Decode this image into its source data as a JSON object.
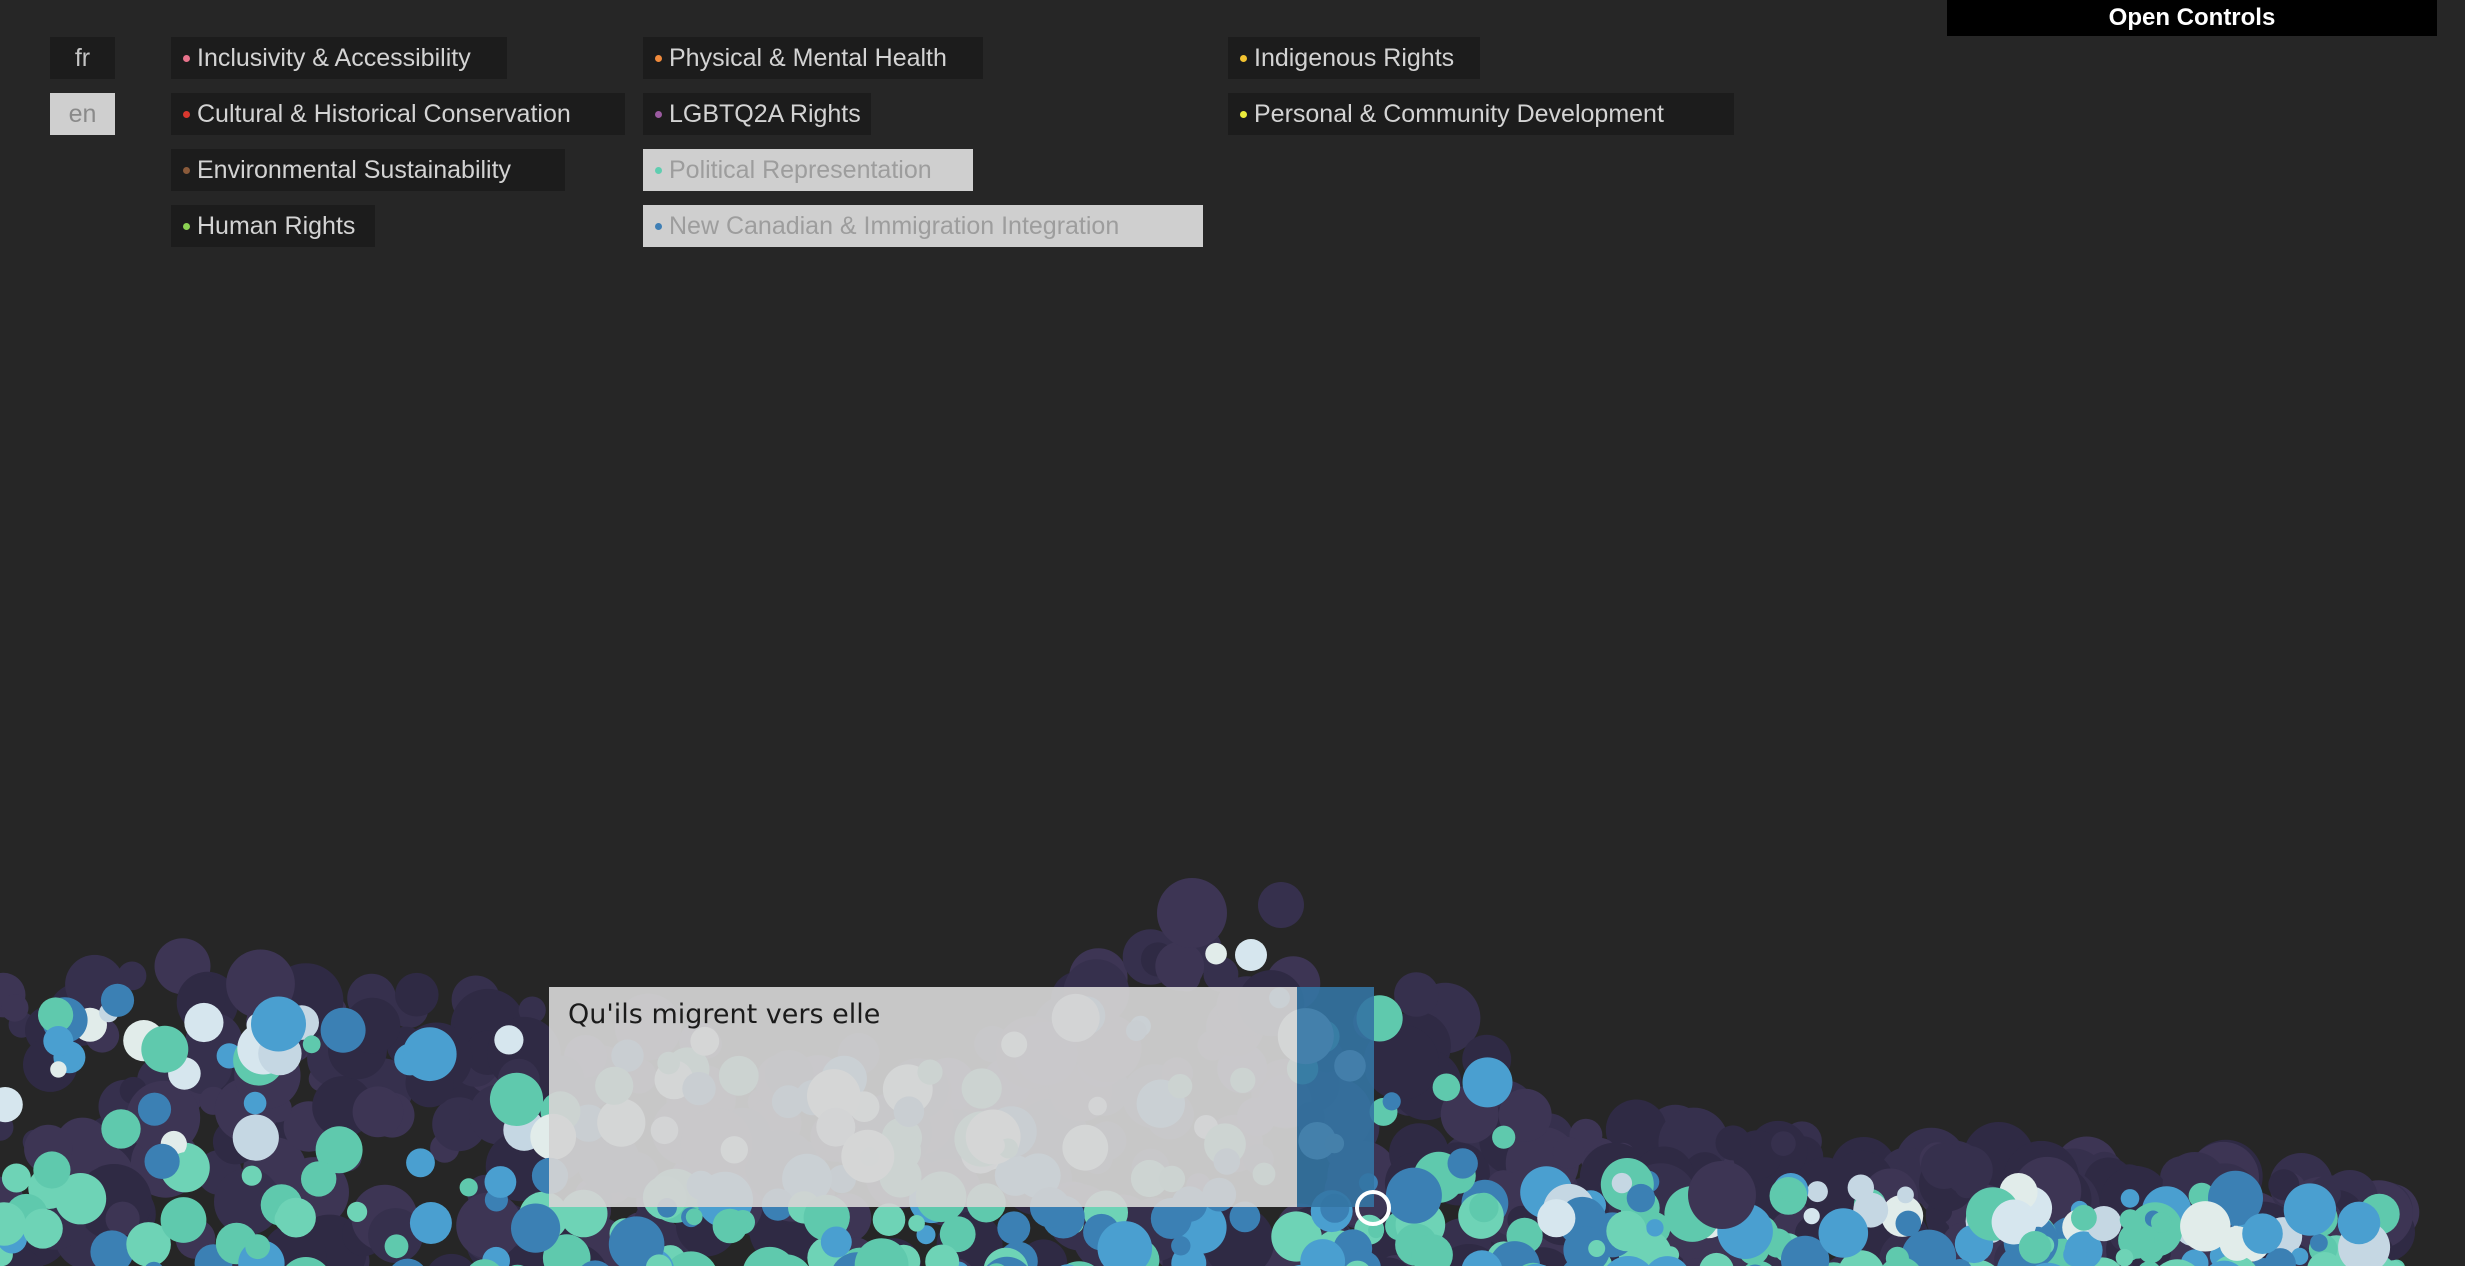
{
  "open_controls_label": "Open Controls",
  "languages": [
    {
      "label": "fr",
      "active": false
    },
    {
      "label": "en",
      "active": true
    }
  ],
  "topics": [
    {
      "label": "Inclusivity & Accessibility",
      "color": "#e8738c",
      "active": false
    },
    {
      "label": "Cultural & Historical Conservation",
      "color": "#d9372e",
      "active": false
    },
    {
      "label": "Environmental Sustainability",
      "color": "#8a5a3a",
      "active": false
    },
    {
      "label": "Human Rights",
      "color": "#8bd152",
      "active": false
    },
    {
      "label": "Physical & Mental Health",
      "color": "#f08a3c",
      "active": false
    },
    {
      "label": "LGBTQ2A Rights",
      "color": "#9b5aa0",
      "active": false
    },
    {
      "label": "Political Representation",
      "color": "#5fcdb0",
      "active": true
    },
    {
      "label": "New Canadian & Immigration Integration",
      "color": "#3f7fb5",
      "active": true
    },
    {
      "label": "Indigenous Rights",
      "color": "#f2c230",
      "active": false
    },
    {
      "label": "Personal & Community Development",
      "color": "#ecec3c",
      "active": false
    }
  ],
  "entry": {
    "text": "Qu'ils migrent vers elle"
  },
  "bubble_colors": [
    "#3d3554",
    "#36304d",
    "#2f2a44",
    "#4a9fd0",
    "#3b80b4",
    "#5fc9ad",
    "#6ed3b6",
    "#d6e6ee",
    "#e1ecea",
    "#c5d7e3"
  ]
}
